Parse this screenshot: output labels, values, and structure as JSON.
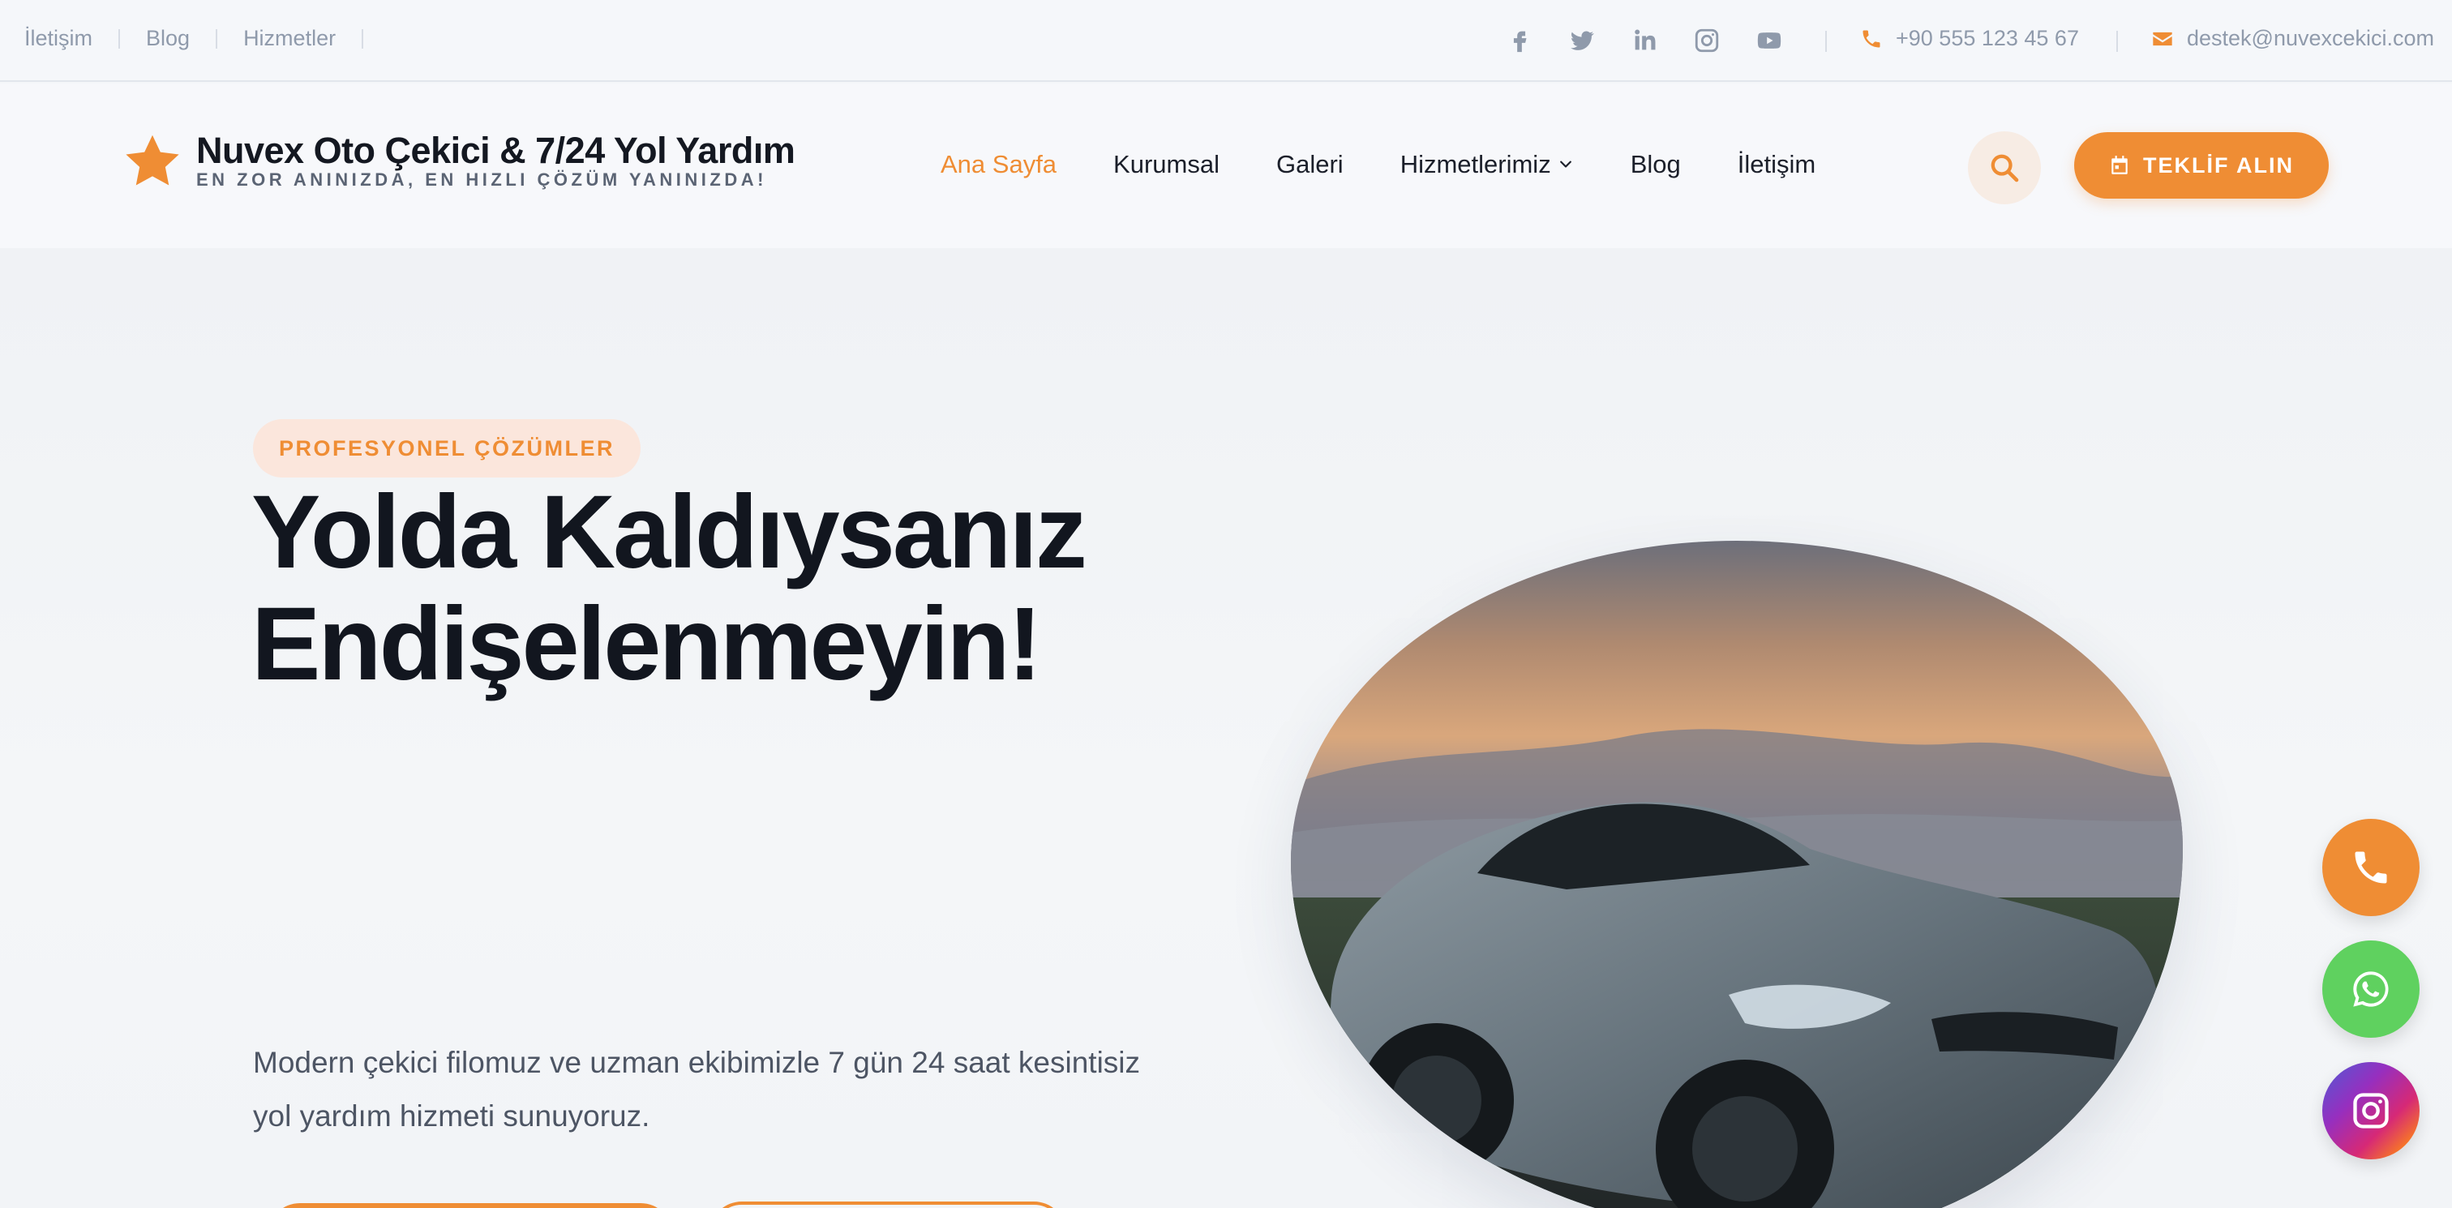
{
  "topbar": {
    "links": [
      "İletişim",
      "Blog",
      "Hizmetler"
    ],
    "social": [
      "facebook-icon",
      "twitter-icon",
      "linkedin-icon",
      "instagram-icon",
      "youtube-icon"
    ],
    "phone": "+90 555 123 45 67",
    "email": "destek@nuvexcekici.com"
  },
  "header": {
    "brand": "Nuvex Oto Çekici & 7/24 Yol Yardım",
    "tagline": "EN ZOR ANINIZDA, EN HIZLI ÇÖZÜM YANINIZDA!",
    "nav": [
      "Ana Sayfa",
      "Kurumsal",
      "Galeri",
      "Hizmetlerimiz",
      "Blog",
      "İletişim"
    ],
    "active_nav": "Ana Sayfa",
    "cta": "TEKLİF ALIN"
  },
  "hero": {
    "badge": "PROFESYONEL ÇÖZÜMLER",
    "headline_line1": "Yolda Kaldıysanız",
    "headline_line2": "Endişelenmeyin!",
    "subtext_line1": "Modern çekici filomuz ve uzman ekibimizle 7 gün 24 saat kesintisiz",
    "subtext_line2": "yol yardım hizmeti sunuyoruz."
  },
  "floating": [
    "phone-icon",
    "whatsapp-icon",
    "instagram-icon"
  ],
  "colors": {
    "accent": "#ef8d34",
    "whatsapp": "#5fd15f",
    "text_dark": "#12161f",
    "text_muted": "#8f9aab"
  }
}
